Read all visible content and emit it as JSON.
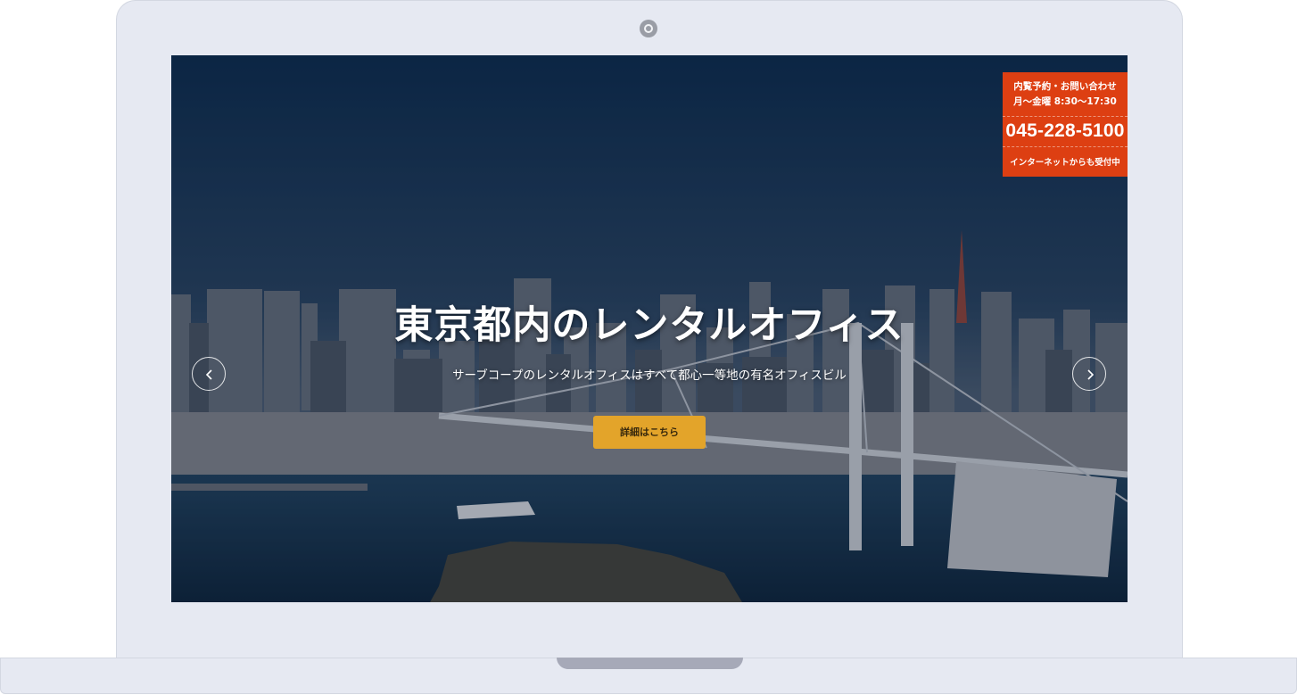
{
  "hero": {
    "title": "東京都内のレンタルオフィス",
    "subtitle": "サーブコープのレンタルオフィスはすべて都心一等地の有名オフィスビル",
    "cta_label": "詳細はこちら"
  },
  "contact": {
    "line1": "内覧予約・お問い合わせ",
    "line2": "月～金曜 8:30～17:30",
    "phone": "045-228-5100",
    "note": "インターネットからも受付中"
  },
  "slider": {
    "prev_icon": "chevron-left-icon",
    "next_icon": "chevron-right-icon"
  },
  "colors": {
    "device": "#e6e9f2",
    "contact_bg": "#dd3f12",
    "cta_bg": "#e3a42a",
    "overlay": "#081223"
  }
}
